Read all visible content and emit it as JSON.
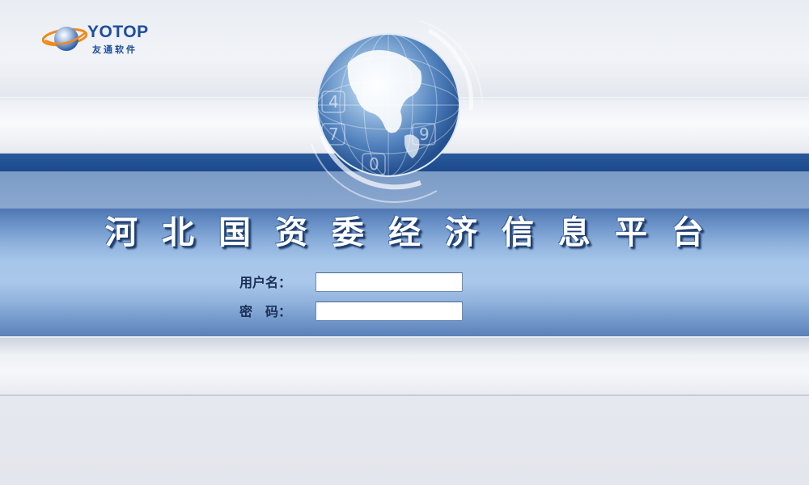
{
  "brand": {
    "name": "YOTOP",
    "subtitle": "友通软件",
    "colors": {
      "primary": "#1d4e9a",
      "accent": "#f08a1c"
    }
  },
  "decoration": {
    "globe": "globe-icon"
  },
  "title": "河北国资委经济信息平台",
  "login": {
    "username_label": "用户名：",
    "username_value": "",
    "password_label": "密　码：",
    "password_value": ""
  }
}
